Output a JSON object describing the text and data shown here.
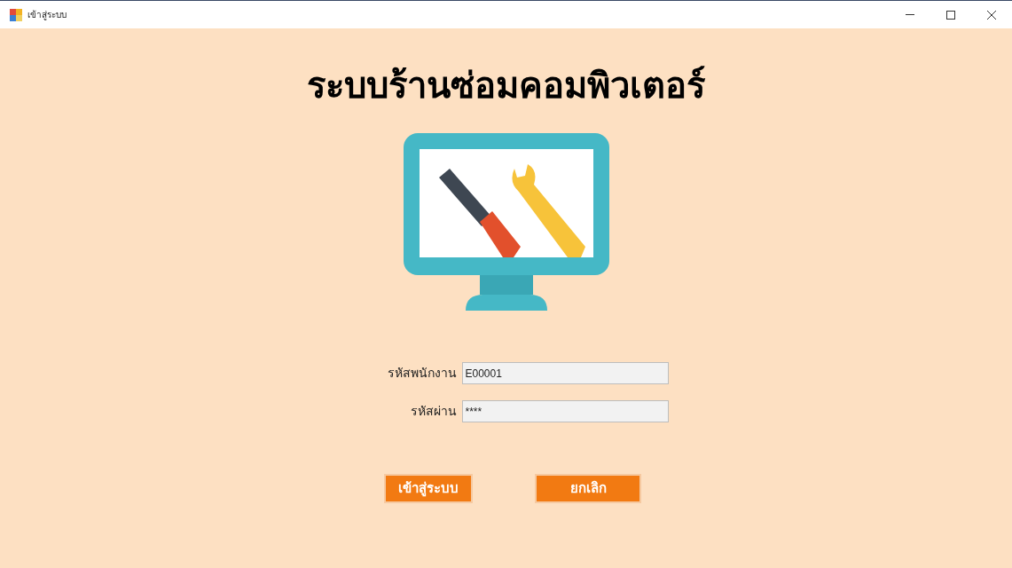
{
  "window": {
    "title": "เข้าสู่ระบบ"
  },
  "heading": "ระบบร้านซ่อมคอมพิวเตอร์",
  "fields": [
    {
      "label": "รหัสพนักงาน",
      "value": "E00001"
    },
    {
      "label": "รหัสผ่าน",
      "value": "****"
    }
  ],
  "buttons": [
    "เข้าสู่ระบบ",
    "ยกเลิก"
  ]
}
